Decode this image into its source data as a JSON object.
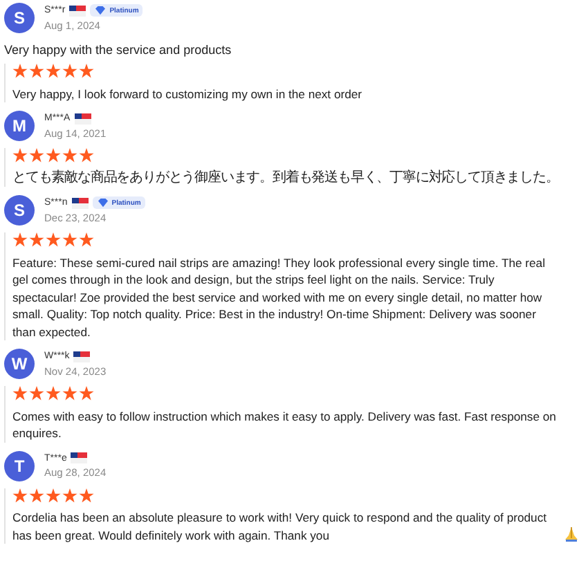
{
  "reviews": [
    {
      "initial": "S",
      "name": "S***r",
      "badge": "Platinum",
      "date": "Aug 1, 2024",
      "title": "Very happy with the service and products",
      "stars": 5,
      "text": "Very happy, I look forward to customizing my own in the next order"
    },
    {
      "initial": "M",
      "name": "M***A",
      "date": "Aug 14, 2021",
      "stars": 5,
      "text": "とても素敵な商品をありがとう御座います。到着も発送も早く、丁寧に対応して頂きました。"
    },
    {
      "initial": "S",
      "name": "S***n",
      "badge": "Platinum",
      "date": "Dec 23, 2024",
      "stars": 5,
      "text": "Feature: These semi-cured nail strips are amazing! They look professional every single time. The real gel comes through in the look and design, but the strips feel light on the nails.  Service: Truly spectacular! Zoe provided the best service and worked with me on every single detail, no matter how small. Quality: Top notch quality. Price: Best in the industry! On-time Shipment: Delivery was sooner than expected."
    },
    {
      "initial": "W",
      "name": "W***k",
      "date": "Nov 24, 2023",
      "stars": 5,
      "text": "Comes with easy to follow instruction which makes it easy to apply. Delivery was fast. Fast response on enquires."
    },
    {
      "initial": "T",
      "name": "T***e",
      "date": "Aug 28, 2024",
      "stars": 5,
      "text": "Cordelia has been an absolute pleasure to work with! Very quick to respond and the quality of product has been great. Would definitely work with again. Thank you",
      "emoji": true
    }
  ]
}
